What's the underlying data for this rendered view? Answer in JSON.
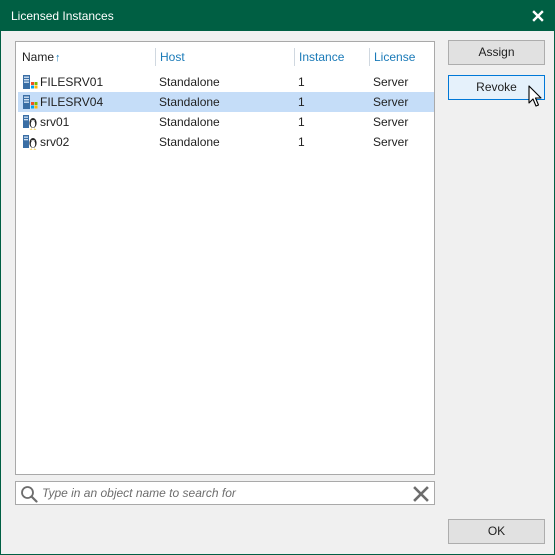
{
  "window": {
    "title": "Licensed Instances",
    "title_bar_color": "#005f43"
  },
  "table": {
    "columns": {
      "name": "Name",
      "host": "Host",
      "instance": "Instance",
      "license": "License"
    },
    "sort_indicator": "↑",
    "rows": [
      {
        "icon": "windows-server-icon",
        "name": "FILESRV01",
        "host": "Standalone",
        "instance": "1",
        "license": "Server",
        "selected": false
      },
      {
        "icon": "windows-server-icon",
        "name": "FILESRV04",
        "host": "Standalone",
        "instance": "1",
        "license": "Server",
        "selected": true
      },
      {
        "icon": "linux-server-icon",
        "name": "srv01",
        "host": "Standalone",
        "instance": "1",
        "license": "Server",
        "selected": false
      },
      {
        "icon": "linux-server-icon",
        "name": "srv02",
        "host": "Standalone",
        "instance": "1",
        "license": "Server",
        "selected": false
      }
    ],
    "selected_row_color": "#c5ddf8"
  },
  "buttons": {
    "assign": "Assign",
    "revoke": "Revoke",
    "ok": "OK"
  },
  "search": {
    "placeholder": "Type in an object name to search for",
    "value": ""
  },
  "accent_color": "#1a7ab8"
}
